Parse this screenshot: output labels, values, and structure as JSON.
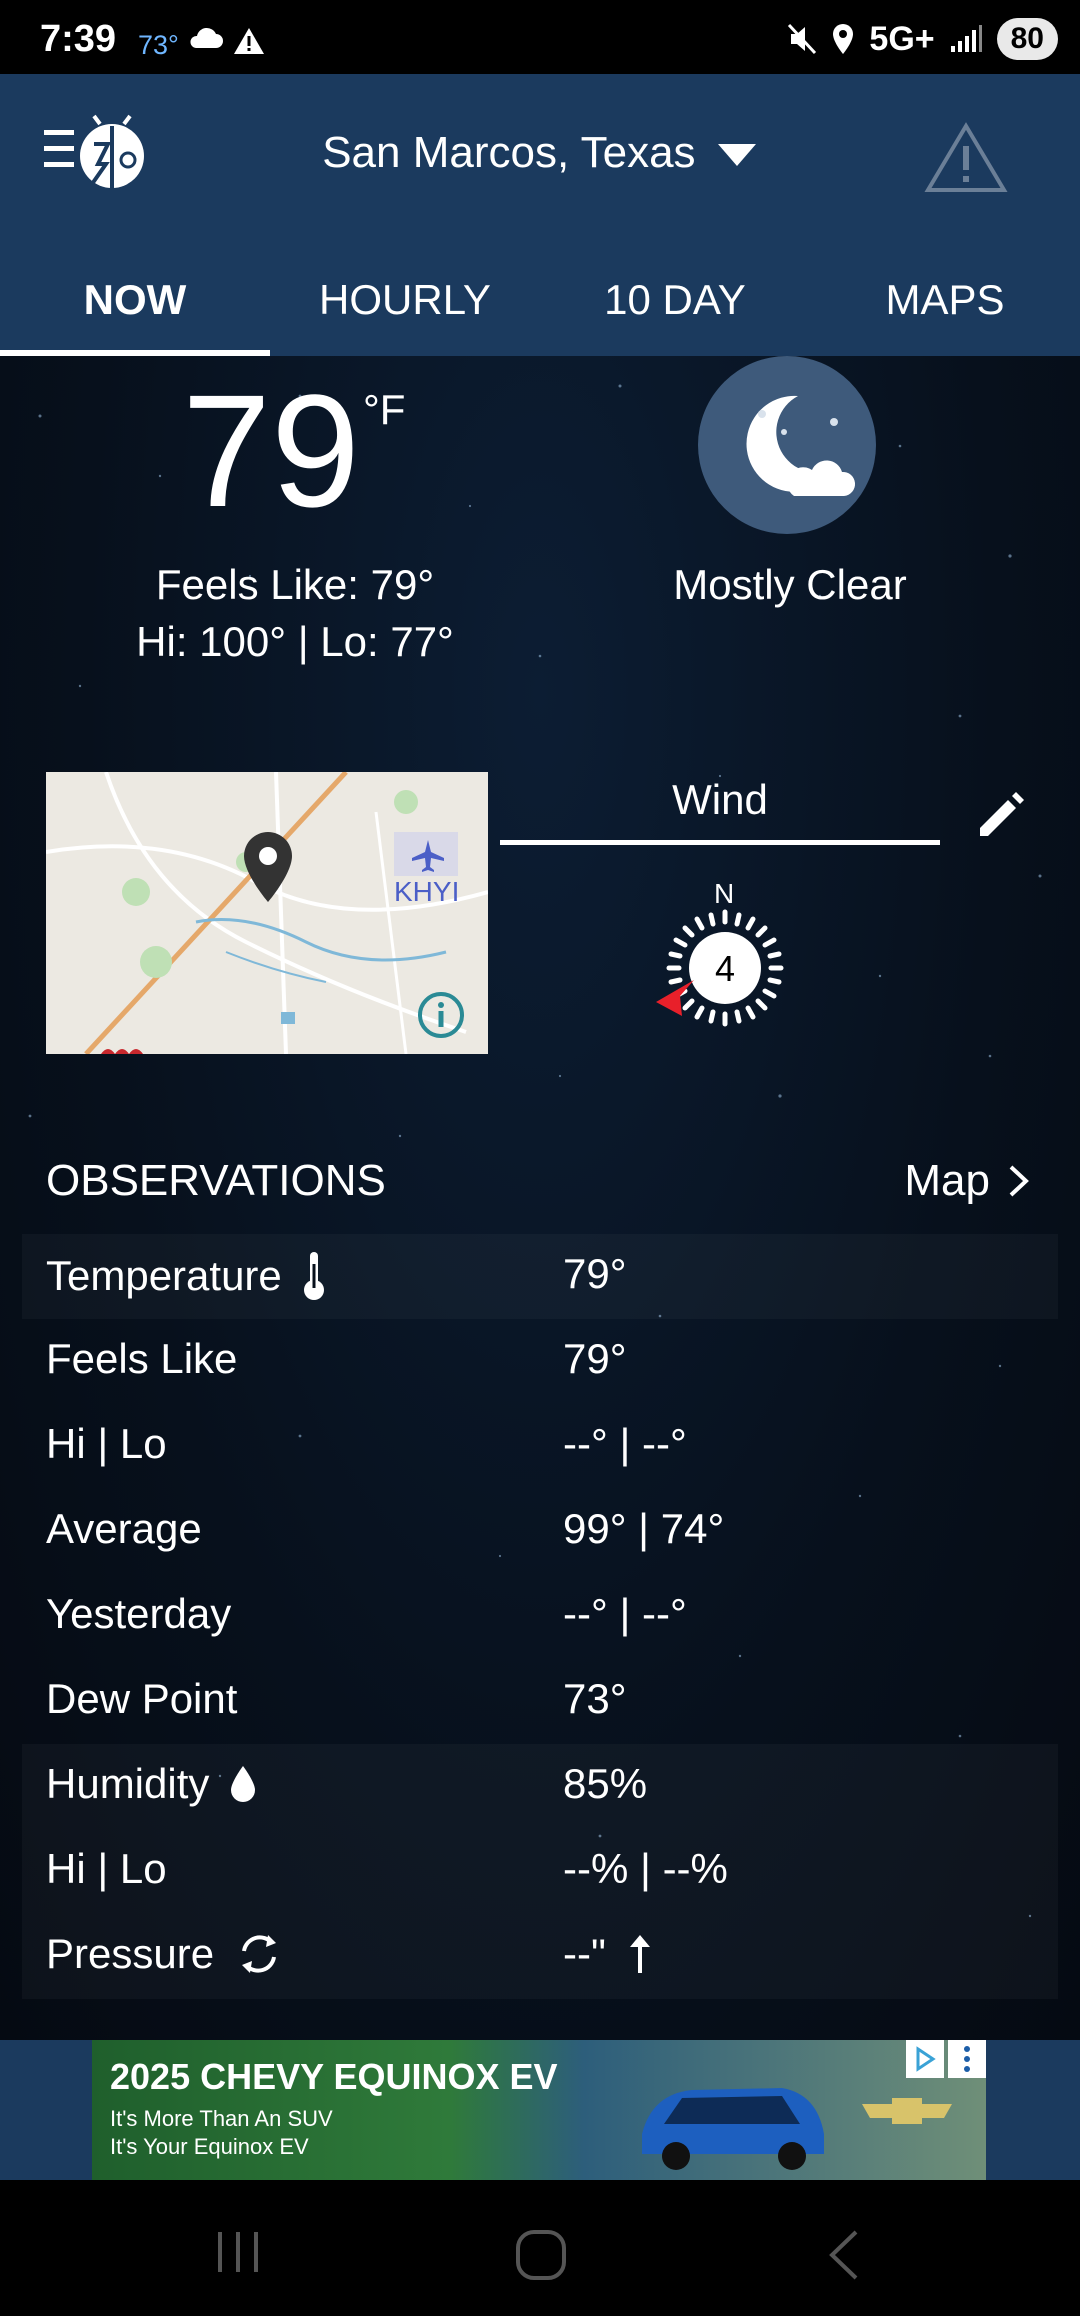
{
  "status_bar": {
    "time": "7:39",
    "temp": "73°",
    "network": "5G+",
    "battery": "80"
  },
  "header": {
    "location": "San Marcos, Texas",
    "tabs": [
      {
        "label": "NOW",
        "active": true
      },
      {
        "label": "HOURLY",
        "active": false
      },
      {
        "label": "10 DAY",
        "active": false
      },
      {
        "label": "MAPS",
        "active": false
      }
    ]
  },
  "current": {
    "temperature": "79",
    "unit": "°F",
    "feels_like": "Feels Like: 79°",
    "hi_lo": "Hi: 100° | Lo: 77°",
    "condition": "Mostly Clear",
    "condition_icon": "moon-cloud-icon"
  },
  "map": {
    "airport_code": "KHYI"
  },
  "wind": {
    "label": "Wind",
    "direction_label": "N",
    "speed": "4"
  },
  "observations": {
    "title": "OBSERVATIONS",
    "map_link": "Map",
    "rows": [
      {
        "label": "Temperature",
        "value": "79°",
        "icon": "thermometer-icon"
      },
      {
        "label": "Feels Like",
        "value": "79°"
      },
      {
        "label": "Hi | Lo",
        "value": "--° | --°"
      },
      {
        "label": "Average",
        "value": "99° | 74°"
      },
      {
        "label": "Yesterday",
        "value": "--° | --°"
      },
      {
        "label": "Dew Point",
        "value": "73°"
      },
      {
        "label": "Humidity",
        "value": "85%",
        "icon": "water-drop-icon"
      },
      {
        "label": "Hi | Lo",
        "value": "--% | --%"
      },
      {
        "label": "Pressure",
        "value": "--\"",
        "icon": "refresh-icon",
        "trend_icon": "arrow-up-icon"
      }
    ]
  },
  "ad": {
    "title": "2025 CHEVY EQUINOX EV",
    "line1": "It's More Than An SUV",
    "line2": "It's Your Equinox EV",
    "brand": "CHEVROLET"
  },
  "colors": {
    "header_bg": "#1b3a5e",
    "moon_circle": "#3e5a7b",
    "compass_arrow": "#e8202a"
  }
}
